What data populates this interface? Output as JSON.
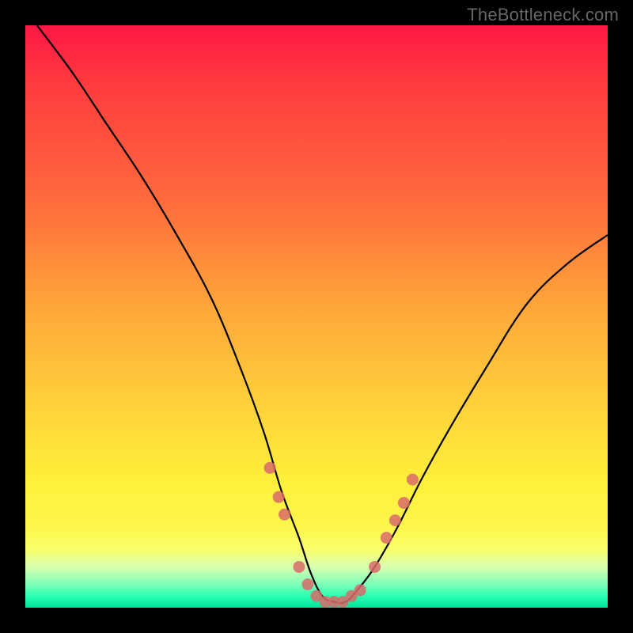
{
  "watermark": "TheBottleneck.com",
  "chart_data": {
    "type": "line",
    "title": "",
    "xlabel": "",
    "ylabel": "",
    "xlim": [
      0,
      100
    ],
    "ylim": [
      0,
      100
    ],
    "series": [
      {
        "name": "curve",
        "x": [
          2,
          8,
          14,
          20,
          26,
          32,
          37,
          41,
          44,
          47,
          49,
          51,
          53,
          55,
          57,
          60,
          64,
          68,
          73,
          79,
          86,
          93,
          100
        ],
        "y": [
          100,
          92,
          83,
          74,
          64,
          53,
          41,
          30,
          20,
          12,
          6,
          2,
          1,
          1,
          3,
          7,
          14,
          22,
          31,
          41,
          52,
          59,
          64
        ]
      }
    ],
    "markers": {
      "name": "highlight-dots",
      "color": "#d96a6a",
      "x": [
        42,
        43.5,
        44.5,
        47,
        48.5,
        50,
        51.5,
        53,
        54.5,
        56,
        57.5,
        60,
        62,
        63.5,
        65,
        66.5
      ],
      "y": [
        24,
        19,
        16,
        7,
        4,
        2,
        1,
        1,
        1,
        2,
        3,
        7,
        12,
        15,
        18,
        22
      ]
    },
    "background_gradient": {
      "top": "#ff1744",
      "mid1": "#ffa53a",
      "mid2": "#ffef3a",
      "bottom": "#00e59a"
    }
  }
}
